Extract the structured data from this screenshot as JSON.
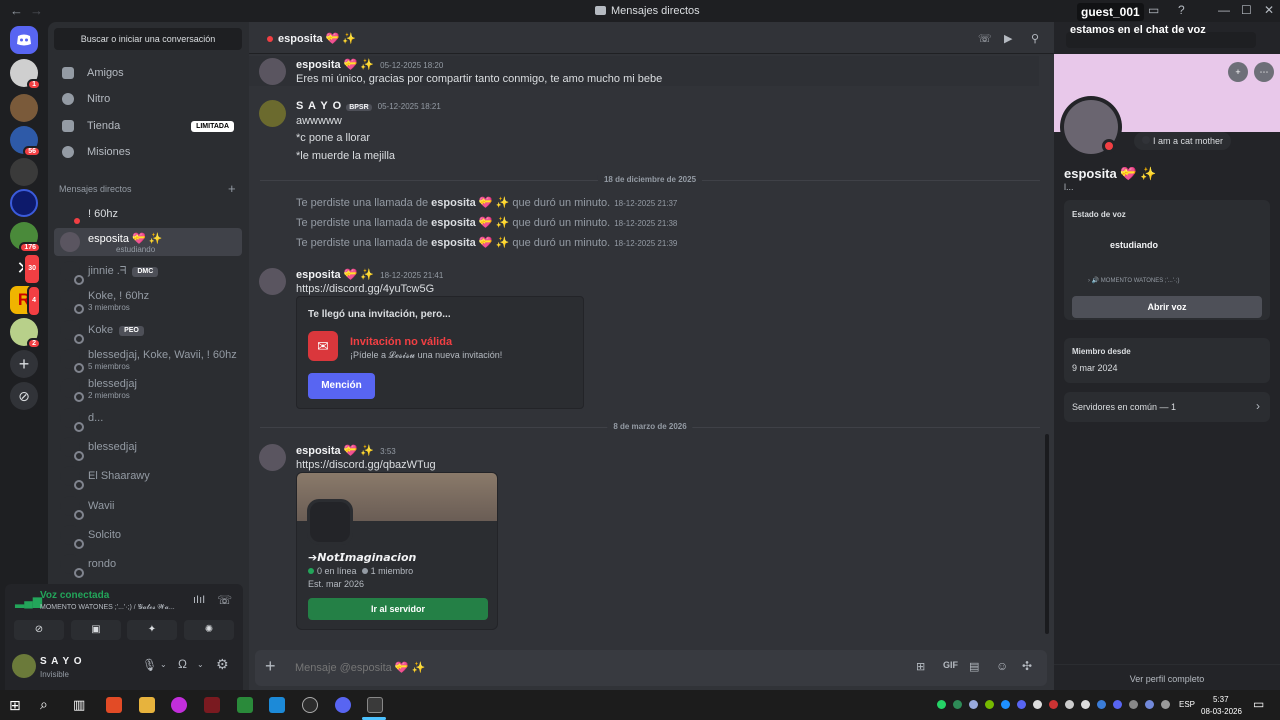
{
  "window": {
    "title": "Mensajes directos",
    "user_badge": "guest_001",
    "voice_overlay": "estamos en el chat de voz"
  },
  "colors": {
    "accent": "#5865f2",
    "green": "#23a55a",
    "red": "#f23f43",
    "link": "#00a8fc",
    "banner": "#e8c8ea"
  },
  "servers": {
    "badges": [
      "1",
      "56",
      "176",
      "30",
      "4",
      "2"
    ]
  },
  "sidebar": {
    "search": "Buscar o iniciar una conversación",
    "nav": [
      {
        "label": "Amigos",
        "icon": "friends-icon"
      },
      {
        "label": "Nitro",
        "icon": "nitro-icon"
      },
      {
        "label": "Tienda",
        "icon": "shop-icon",
        "tag": "LIMITADA"
      },
      {
        "label": "Misiones",
        "icon": "quests-icon"
      }
    ],
    "dm_header": "Mensajes directos",
    "dms": [
      {
        "name": "! 60hz",
        "sub": ""
      },
      {
        "name": "esposita 💝 ✨",
        "sub": "estudiando"
      },
      {
        "name": "jinnie .ᖷ",
        "tag": "DMC",
        "sub": ""
      },
      {
        "name": "Koke, ! 60hz",
        "sub": "3 miembros"
      },
      {
        "name": "Koke",
        "tag": "PEO",
        "sub": ""
      },
      {
        "name": "blessedjaj, Koke, Wavii, ! 60hz",
        "sub": "5 miembros"
      },
      {
        "name": "blessedjaj",
        "sub": "2 miembros"
      },
      {
        "name": "d...",
        "sub": ""
      },
      {
        "name": "blessedjaj",
        "sub": ""
      },
      {
        "name": "El Shaarawy",
        "sub": ""
      },
      {
        "name": "Wavii",
        "sub": ""
      },
      {
        "name": "Solcito",
        "sub": ""
      },
      {
        "name": "rondo",
        "sub": ""
      }
    ]
  },
  "voice": {
    "status": "Voz conectada",
    "channel": "MOMENTO WATONES ;'...'·;) / 𝓖𝓪𝓽𝓸𝓼 𝓦𝓪..."
  },
  "user": {
    "name": "S A Y O",
    "status": "Invisible"
  },
  "chat": {
    "header": "esposita 💝 ✨",
    "messages": [
      {
        "author": "esposita 💝 ✨",
        "time": "05-12-2025 18:20",
        "lines": [
          "Eres mi único, gracias por compartir tanto conmigo, te amo mucho mi bebe"
        ]
      },
      {
        "author": "S A Y O",
        "tag": "BPSR",
        "time": "05-12-2025 18:21",
        "lines": [
          "awwwww",
          "*c pone a llorar",
          "*le muerde  la mejilla"
        ]
      }
    ],
    "divider1": "18 de diciembre de 2025",
    "calls": [
      {
        "pre": "Te perdiste una llamada de",
        "who": "esposita 💝 ✨",
        "post": "que duró un minuto.",
        "time": "18-12-2025 21:37"
      },
      {
        "pre": "Te perdiste una llamada de",
        "who": "esposita 💝 ✨",
        "post": "que duró un minuto.",
        "time": "18-12-2025 21:38"
      },
      {
        "pre": "Te perdiste una llamada de",
        "who": "esposita 💝 ✨",
        "post": "que duró un minuto.",
        "time": "18-12-2025 21:39"
      }
    ],
    "msg3": {
      "author": "esposita 💝 ✨",
      "time": "18-12-2025 21:41",
      "link": "https://discord.gg/4yuTcw5G"
    },
    "invite": {
      "heading": "Te llegó una invitación, pero...",
      "title": "Invitación no válida",
      "desc": "¡Pídele a 𝓛𝓮𝓼𝓲𝓼𝓾 una nueva invitación!",
      "button": "Mención"
    },
    "divider2": "8 de marzo de 2026",
    "msg4": {
      "author": "esposita 💝 ✨",
      "time": "3:53",
      "link": "https://discord.gg/qbazWTug"
    },
    "server": {
      "name": "➔𝙉𝙤𝙩𝙄𝙢𝙖𝙜𝙞𝙣𝙖𝙘𝙞𝙤𝙣",
      "online": "0 en línea",
      "members": "1 miembro",
      "est": "Est. mar 2026",
      "button": "Ir al servidor"
    },
    "placeholder": "Mensaje @esposita 💝 ✨"
  },
  "profile": {
    "name": "esposita 💝 ✨",
    "handle": "l...",
    "bio": "I am a cat mother",
    "voice_label": "Estado de voz",
    "voice_channel": "estudiando",
    "voice_sub": "🔊 MOMENTO WATONES ;'...'·;)",
    "open_voice": "Abrir voz",
    "member_since_label": "Miembro desde",
    "member_since": "9 mar 2024",
    "common": "Servidores en común — 1",
    "full_profile": "Ver perfil completo"
  },
  "taskbar": {
    "lang": "ESP",
    "time": "5:37",
    "date": "08-03-2026"
  }
}
